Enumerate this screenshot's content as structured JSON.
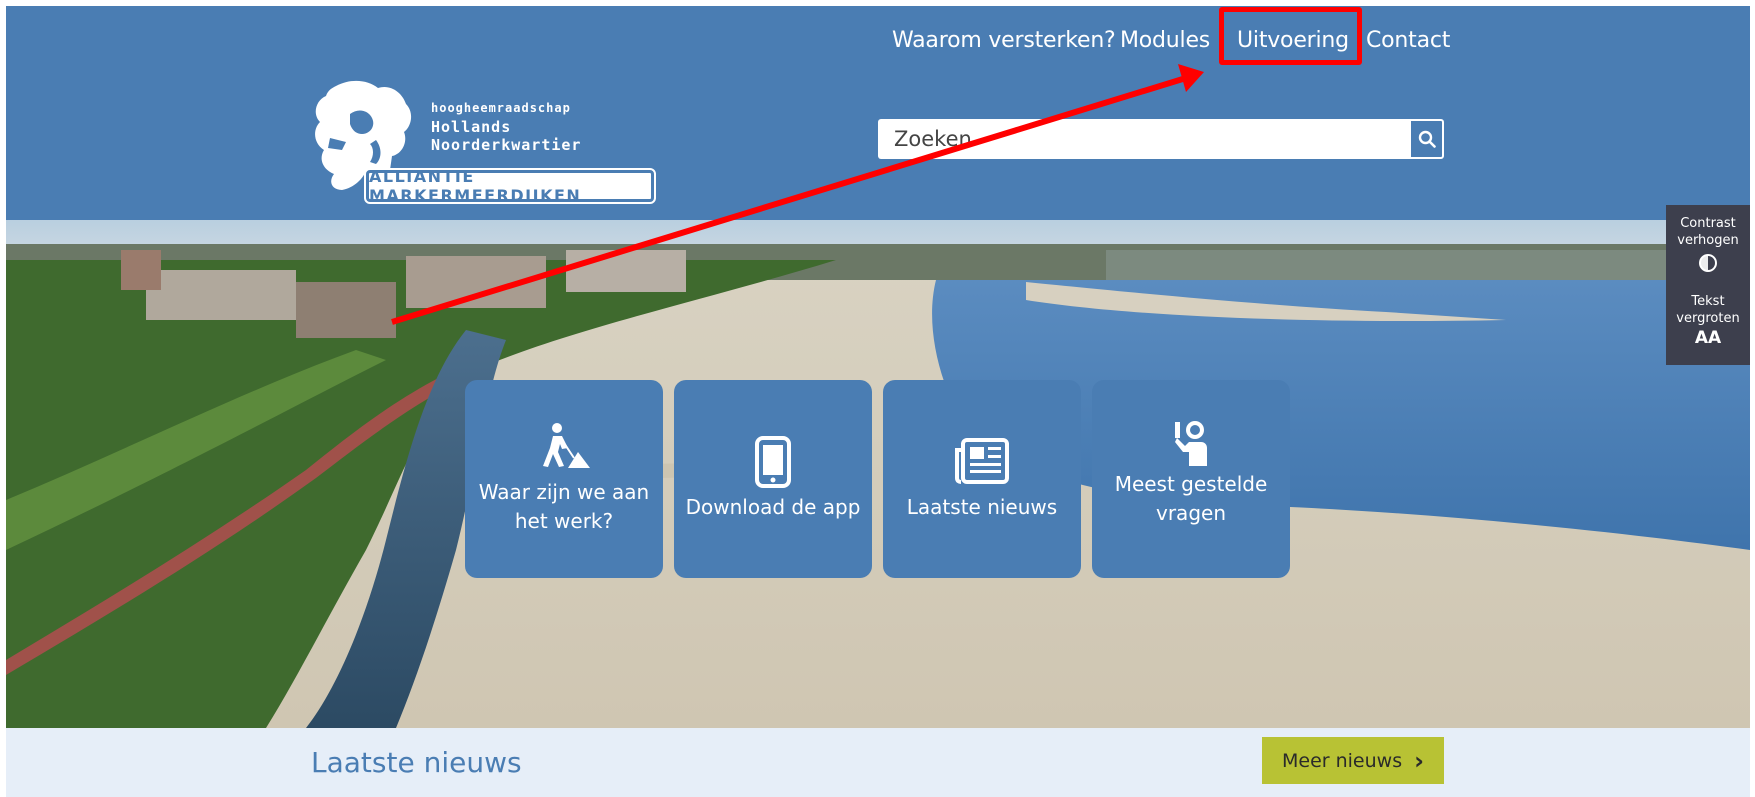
{
  "nav": {
    "items": [
      {
        "label": "Waarom versterken?"
      },
      {
        "label": "Modules"
      },
      {
        "label": "Uitvoering"
      },
      {
        "label": "Contact"
      }
    ]
  },
  "logo": {
    "small": "hoogheemraadschap",
    "line1": "Hollands",
    "line2": "Noorderkwartier",
    "badge": "ALLIANTIE MARKERMEERDIJKEN"
  },
  "search": {
    "placeholder": "Zoeken"
  },
  "tiles": [
    {
      "label": "Waar zijn we aan het werk?",
      "icon": "worker-icon"
    },
    {
      "label": "Download de app",
      "icon": "smartphone-icon"
    },
    {
      "label": "Laatste nieuws",
      "icon": "newspaper-icon"
    },
    {
      "label": "Meest gestelde vragen",
      "icon": "question-person-icon"
    }
  ],
  "accessibility": {
    "contrast_line1": "Contrast",
    "contrast_line2": "verhogen",
    "text_line1": "Tekst",
    "text_line2": "vergroten",
    "text_symbol": "AA"
  },
  "news": {
    "title": "Laatste nieuws",
    "more_label": "Meer nieuws",
    "more_chevron": "›"
  },
  "colors": {
    "brand_blue": "#4a7db3",
    "highlight_red": "#ff0000",
    "news_button": "#b8c234",
    "a11y_panel": "#3d3f4d"
  }
}
